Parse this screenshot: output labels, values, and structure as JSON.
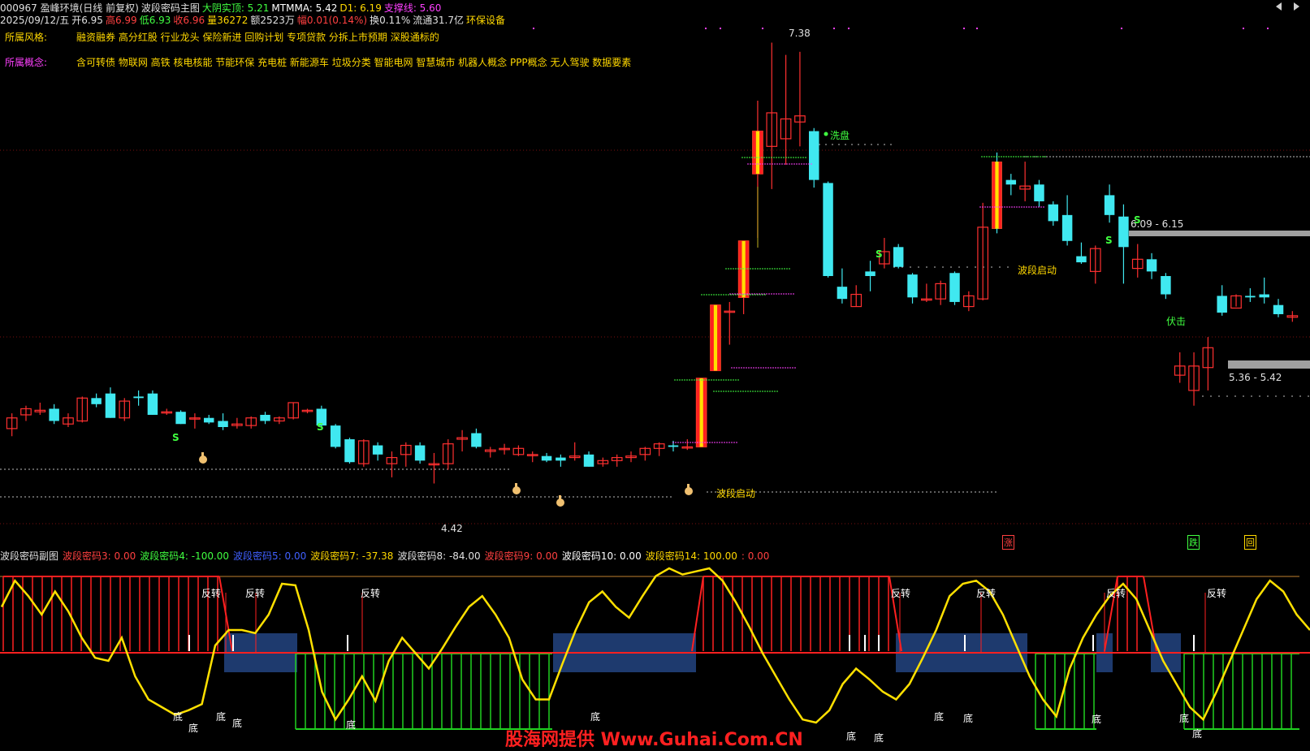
{
  "header": {
    "line1": [
      {
        "text": "000967 盈峰环境(日线 前复权)",
        "color": "#e0e0e0"
      },
      {
        "text": "波段密码主图",
        "color": "#e0e0e0"
      },
      {
        "text": "大阴实顶: 5.21",
        "color": "#40ff40"
      },
      {
        "text": "MTMMA: 5.42",
        "color": "#ffffff"
      },
      {
        "text": "D1: 6.19",
        "color": "#ffd800"
      },
      {
        "text": "支撑线: 5.60",
        "color": "#ff40ff"
      }
    ],
    "line2": [
      {
        "text": "2025/09/12/五",
        "color": "#e0e0e0"
      },
      {
        "text": "开6.95",
        "color": "#e0e0e0"
      },
      {
        "text": "高6.99",
        "color": "#ff4040"
      },
      {
        "text": "低6.93",
        "color": "#40ff40"
      },
      {
        "text": "收6.96",
        "color": "#ff4040"
      },
      {
        "text": "量36272",
        "color": "#ffd800"
      },
      {
        "text": "额2523万",
        "color": "#e0e0e0"
      },
      {
        "text": "幅0.01(0.14%)",
        "color": "#ff4040"
      },
      {
        "text": "换0.11%",
        "color": "#e0e0e0"
      },
      {
        "text": "流通31.7亿",
        "color": "#e0e0e0"
      },
      {
        "text": "环保设备",
        "color": "#ffd800"
      }
    ]
  },
  "info": {
    "style_label": "所属风格:",
    "style_value": "融资融券 高分红股 行业龙头 保险新进 回购计划 专项贷款 分拆上市预期 深股通标的",
    "concept_label": "所属概念:",
    "concept_value": "含可转债 物联网 高铁 核电核能 节能环保 充电桩 新能源车 垃圾分类 智能电网 智慧城市 机器人概念 PPP概念 无人驾驶 数据要素"
  },
  "annotations": {
    "high_price": "7.38",
    "low_price": "4.42",
    "wash": "洗盘",
    "start1": "波段启动",
    "start2": "波段启动",
    "ambush": "伏击",
    "range_top": "6.09 - 6.15",
    "range_bottom": "5.36 - 5.42",
    "s_mark": "S",
    "rise_mark": "涨",
    "fall_mark": "跌",
    "box_mark": "回"
  },
  "sub_header": [
    {
      "text": "波段密码副图",
      "color": "#e0e0e0"
    },
    {
      "text": "波段密码3: 0.00",
      "color": "#ff4040"
    },
    {
      "text": "波段密码4: -100.00",
      "color": "#40ff40"
    },
    {
      "text": "波段密码5: 0.00",
      "color": "#4060ff"
    },
    {
      "text": "波段密码7: -37.38",
      "color": "#ffd800"
    },
    {
      "text": "波段密码8: -84.00",
      "color": "#e0e0e0"
    },
    {
      "text": "波段密码9: 0.00",
      "color": "#ff4040"
    },
    {
      "text": "波段密码10: 0.00",
      "color": "#ffffff"
    },
    {
      "text": "波段密码14: 100.00",
      "color": "#ffd800"
    },
    {
      "text": ": 0.00",
      "color": "#ff4040"
    }
  ],
  "sub_labels": {
    "reverse": "反转",
    "bottom": "底"
  },
  "watermark": "股海网提供 Www.Guhai.Com.CN",
  "colors": {
    "up": "#ff3030",
    "down": "#40e8f0",
    "yellow": "#ffe000",
    "green_bar": "#20e020",
    "navy": "#1e3a6e"
  },
  "chart_data": {
    "type": "candlestick",
    "price_range": [
      4.2,
      7.5
    ],
    "candles": [
      {
        "o": 4.85,
        "h": 4.95,
        "l": 4.8,
        "c": 4.92
      },
      {
        "o": 4.94,
        "h": 5.0,
        "l": 4.9,
        "c": 4.98
      },
      {
        "o": 4.96,
        "h": 5.02,
        "l": 4.94,
        "c": 4.97
      },
      {
        "o": 4.98,
        "h": 5.01,
        "l": 4.88,
        "c": 4.9
      },
      {
        "o": 4.88,
        "h": 4.95,
        "l": 4.86,
        "c": 4.92
      },
      {
        "o": 4.9,
        "h": 5.06,
        "l": 4.89,
        "c": 5.05
      },
      {
        "o": 5.05,
        "h": 5.08,
        "l": 4.99,
        "c": 5.01
      },
      {
        "o": 5.08,
        "h": 5.12,
        "l": 4.92,
        "c": 4.92
      },
      {
        "o": 4.92,
        "h": 5.05,
        "l": 4.9,
        "c": 5.03
      },
      {
        "o": 5.06,
        "h": 5.1,
        "l": 5.0,
        "c": 5.05
      },
      {
        "o": 5.08,
        "h": 5.1,
        "l": 4.94,
        "c": 4.94
      },
      {
        "o": 4.96,
        "h": 4.98,
        "l": 4.94,
        "c": 4.96
      },
      {
        "o": 4.96,
        "h": 4.97,
        "l": 4.88,
        "c": 4.88
      },
      {
        "o": 4.92,
        "h": 4.95,
        "l": 4.85,
        "c": 4.92
      },
      {
        "o": 4.92,
        "h": 4.94,
        "l": 4.88,
        "c": 4.89
      },
      {
        "o": 4.9,
        "h": 4.95,
        "l": 4.84,
        "c": 4.86
      },
      {
        "o": 4.87,
        "h": 4.92,
        "l": 4.85,
        "c": 4.88
      },
      {
        "o": 4.87,
        "h": 4.93,
        "l": 4.85,
        "c": 4.92
      },
      {
        "o": 4.94,
        "h": 4.96,
        "l": 4.88,
        "c": 4.9
      },
      {
        "o": 4.9,
        "h": 4.93,
        "l": 4.88,
        "c": 4.92
      },
      {
        "o": 4.92,
        "h": 5.02,
        "l": 4.91,
        "c": 5.02
      },
      {
        "o": 4.97,
        "h": 4.98,
        "l": 4.95,
        "c": 4.97
      },
      {
        "o": 4.98,
        "h": 5.0,
        "l": 4.86,
        "c": 4.87
      },
      {
        "o": 4.87,
        "h": 4.88,
        "l": 4.72,
        "c": 4.73
      },
      {
        "o": 4.78,
        "h": 4.79,
        "l": 4.62,
        "c": 4.63
      },
      {
        "o": 4.62,
        "h": 4.78,
        "l": 4.6,
        "c": 4.77
      },
      {
        "o": 4.74,
        "h": 4.76,
        "l": 4.64,
        "c": 4.68
      },
      {
        "o": 4.62,
        "h": 4.7,
        "l": 4.53,
        "c": 4.66
      },
      {
        "o": 4.68,
        "h": 4.76,
        "l": 4.6,
        "c": 4.74
      },
      {
        "o": 4.74,
        "h": 4.76,
        "l": 4.62,
        "c": 4.64
      },
      {
        "o": 4.62,
        "h": 4.69,
        "l": 4.49,
        "c": 4.62
      },
      {
        "o": 4.62,
        "h": 4.78,
        "l": 4.58,
        "c": 4.75
      },
      {
        "o": 4.78,
        "h": 4.84,
        "l": 4.7,
        "c": 4.79
      },
      {
        "o": 4.82,
        "h": 4.85,
        "l": 4.72,
        "c": 4.73
      },
      {
        "o": 4.7,
        "h": 4.73,
        "l": 4.66,
        "c": 4.71
      },
      {
        "o": 4.72,
        "h": 4.75,
        "l": 4.68,
        "c": 4.72
      },
      {
        "o": 4.68,
        "h": 4.74,
        "l": 4.67,
        "c": 4.72
      },
      {
        "o": 4.68,
        "h": 4.7,
        "l": 4.63,
        "c": 4.68
      },
      {
        "o": 4.67,
        "h": 4.69,
        "l": 4.63,
        "c": 4.64
      },
      {
        "o": 4.66,
        "h": 4.68,
        "l": 4.6,
        "c": 4.64
      },
      {
        "o": 4.66,
        "h": 4.76,
        "l": 4.64,
        "c": 4.67
      },
      {
        "o": 4.68,
        "h": 4.7,
        "l": 4.6,
        "c": 4.6
      },
      {
        "o": 4.62,
        "h": 4.66,
        "l": 4.6,
        "c": 4.64
      },
      {
        "o": 4.64,
        "h": 4.68,
        "l": 4.6,
        "c": 4.66
      },
      {
        "o": 4.66,
        "h": 4.7,
        "l": 4.63,
        "c": 4.67
      },
      {
        "o": 4.68,
        "h": 4.73,
        "l": 4.64,
        "c": 4.72
      },
      {
        "o": 4.72,
        "h": 4.76,
        "l": 4.67,
        "c": 4.75
      },
      {
        "o": 4.74,
        "h": 4.77,
        "l": 4.7,
        "c": 4.73
      },
      {
        "o": 4.73,
        "h": 4.78,
        "l": 4.71,
        "c": 4.73
      },
      {
        "o": 4.73,
        "h": 5.18,
        "l": 4.73,
        "c": 5.18
      },
      {
        "o": 5.23,
        "h": 5.66,
        "l": 5.23,
        "c": 5.66
      },
      {
        "o": 5.62,
        "h": 5.68,
        "l": 5.4,
        "c": 5.62
      },
      {
        "o": 5.71,
        "h": 6.08,
        "l": 5.6,
        "c": 6.08
      },
      {
        "o": 6.52,
        "h": 7.0,
        "l": 6.1,
        "c": 6.8
      },
      {
        "o": 6.7,
        "h": 7.38,
        "l": 6.42,
        "c": 6.92
      },
      {
        "o": 6.75,
        "h": 7.3,
        "l": 6.58,
        "c": 6.88
      },
      {
        "o": 6.86,
        "h": 7.32,
        "l": 6.7,
        "c": 6.9
      },
      {
        "o": 6.8,
        "h": 6.82,
        "l": 6.43,
        "c": 6.48
      },
      {
        "o": 6.46,
        "h": 6.47,
        "l": 5.84,
        "c": 5.85
      },
      {
        "o": 5.78,
        "h": 5.9,
        "l": 5.67,
        "c": 5.7
      },
      {
        "o": 5.65,
        "h": 5.79,
        "l": 5.65,
        "c": 5.73
      },
      {
        "o": 5.88,
        "h": 5.95,
        "l": 5.75,
        "c": 5.85
      },
      {
        "o": 5.93,
        "h": 6.1,
        "l": 5.9,
        "c": 6.01
      },
      {
        "o": 6.04,
        "h": 6.06,
        "l": 5.9,
        "c": 5.91
      },
      {
        "o": 5.86,
        "h": 5.87,
        "l": 5.67,
        "c": 5.71
      },
      {
        "o": 5.7,
        "h": 5.8,
        "l": 5.68,
        "c": 5.7
      },
      {
        "o": 5.7,
        "h": 5.82,
        "l": 5.66,
        "c": 5.8
      },
      {
        "o": 5.87,
        "h": 5.88,
        "l": 5.66,
        "c": 5.68
      },
      {
        "o": 5.65,
        "h": 5.75,
        "l": 5.62,
        "c": 5.72
      },
      {
        "o": 5.7,
        "h": 6.33,
        "l": 5.69,
        "c": 6.17
      },
      {
        "o": 6.6,
        "h": 6.66,
        "l": 6.13,
        "c": 6.16
      },
      {
        "o": 6.48,
        "h": 6.52,
        "l": 6.38,
        "c": 6.45
      },
      {
        "o": 6.42,
        "h": 6.6,
        "l": 6.34,
        "c": 6.44
      },
      {
        "o": 6.45,
        "h": 6.48,
        "l": 6.3,
        "c": 6.34
      },
      {
        "o": 6.32,
        "h": 6.34,
        "l": 6.18,
        "c": 6.21
      },
      {
        "o": 6.25,
        "h": 6.38,
        "l": 6.05,
        "c": 6.08
      },
      {
        "o": 5.98,
        "h": 6.07,
        "l": 5.93,
        "c": 5.94
      },
      {
        "o": 5.88,
        "h": 6.05,
        "l": 5.8,
        "c": 6.03
      },
      {
        "o": 6.38,
        "h": 6.45,
        "l": 6.2,
        "c": 6.25
      },
      {
        "o": 6.24,
        "h": 6.32,
        "l": 5.8,
        "c": 6.04
      },
      {
        "o": 5.9,
        "h": 6.06,
        "l": 5.84,
        "c": 5.96
      },
      {
        "o": 5.96,
        "h": 6.0,
        "l": 5.83,
        "c": 5.88
      },
      {
        "o": 5.85,
        "h": 5.87,
        "l": 5.7,
        "c": 5.73
      },
      {
        "o": 5.2,
        "h": 5.35,
        "l": 5.15,
        "c": 5.26
      },
      {
        "o": 5.1,
        "h": 5.35,
        "l": 5.0,
        "c": 5.26
      },
      {
        "o": 5.25,
        "h": 5.45,
        "l": 5.1,
        "c": 5.38
      },
      {
        "o": 5.72,
        "h": 5.79,
        "l": 5.59,
        "c": 5.61
      },
      {
        "o": 5.64,
        "h": 5.73,
        "l": 5.65,
        "c": 5.72
      },
      {
        "o": 5.72,
        "h": 5.77,
        "l": 5.68,
        "c": 5.71
      },
      {
        "o": 5.73,
        "h": 5.84,
        "l": 5.67,
        "c": 5.71
      },
      {
        "o": 5.66,
        "h": 5.7,
        "l": 5.58,
        "c": 5.6
      },
      {
        "o": 5.58,
        "h": 5.62,
        "l": 5.55,
        "c": 5.59
      }
    ],
    "sub_curve": [
      75,
      92,
      82,
      70,
      85,
      72,
      55,
      42,
      40,
      55,
      30,
      15,
      10,
      5,
      8,
      12,
      50,
      60,
      60,
      58,
      70,
      90,
      89,
      60,
      20,
      2,
      15,
      30,
      14,
      40,
      55,
      45,
      35,
      48,
      62,
      75,
      82,
      70,
      55,
      28,
      15,
      15,
      38,
      60,
      78,
      85,
      75,
      68,
      82,
      95,
      100,
      96,
      98,
      100,
      92,
      78,
      62,
      45,
      30,
      15,
      2,
      0,
      8,
      25,
      35,
      28,
      20,
      15,
      25,
      42,
      60,
      82,
      90,
      92,
      85,
      70,
      50,
      30,
      15,
      4,
      35,
      55,
      70,
      82,
      90,
      80,
      60,
      40,
      25,
      10,
      2,
      20,
      40,
      60,
      80,
      92,
      85,
      70,
      60
    ]
  }
}
